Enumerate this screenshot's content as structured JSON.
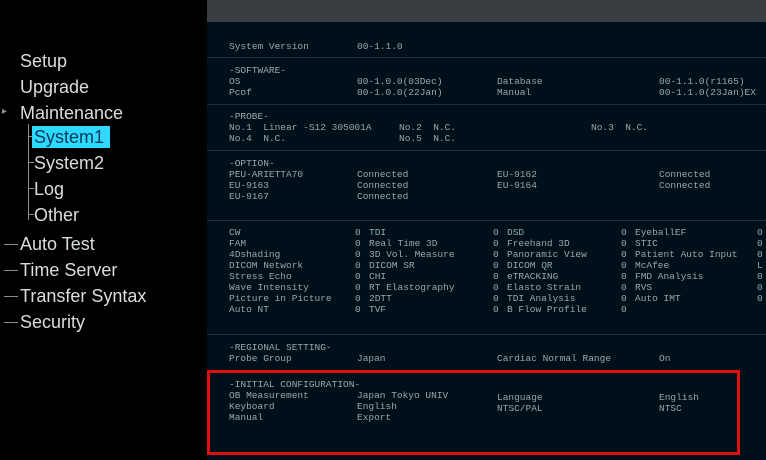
{
  "nav": {
    "setup": "Setup",
    "upgrade": "Upgrade",
    "maintenance": "Maintenance",
    "system1": "System1",
    "system2": "System2",
    "log": "Log",
    "other": "Other",
    "auto_test": "Auto Test",
    "time_server": "Time Server",
    "transfer_syntax": "Transfer Syntax",
    "security": "Security"
  },
  "system_version": {
    "label": "System Version",
    "value": "00-1.1.0"
  },
  "software": {
    "header": "-SOFTWARE-",
    "os_label": "OS",
    "os_value": "00-1.0.0(03Dec)",
    "pcof_label": "Pcof",
    "pcof_value": "00-1.0.0(22Jan)",
    "db_label": "Database",
    "db_value": "00-1.1.0(r1165)",
    "manual_label": "Manual",
    "manual_value": "00-1.1.0(23Jan)EX"
  },
  "probe": {
    "header": "-PROBE-",
    "no1": "No.1  Linear -S12 305001A",
    "no2": "No.2  N.C.",
    "no3": "No.3  N.C.",
    "no4": "No.4  N.C.",
    "no5": "No.5  N.C."
  },
  "option": {
    "header": "-OPTION-",
    "rows": [
      {
        "name": "PEU-ARIETTA70",
        "status": "Connected"
      },
      {
        "name": "EU-9163",
        "status": "Connected"
      },
      {
        "name": "EU-9167",
        "status": "Connected"
      },
      {
        "name": "EU-9162",
        "status": "Connected"
      },
      {
        "name": "EU-9164",
        "status": "Connected"
      }
    ]
  },
  "features": {
    "col1": [
      "CW",
      "FAM",
      "4Dshading",
      "DICOM Network",
      "Stress Echo",
      "Wave Intensity",
      "Picture in Picture",
      "Auto NT"
    ],
    "col1v": [
      "0",
      "0",
      "0",
      "0",
      "0",
      "0",
      "0",
      "0"
    ],
    "col2": [
      "TDI",
      "Real Time 3D",
      "3D Vol. Measure",
      "DICOM SR",
      "CHI",
      "RT Elastography",
      "2DTT",
      "TVF"
    ],
    "col2v": [
      "0",
      "0",
      "0",
      "0",
      "0",
      "0",
      "0",
      "0"
    ],
    "col3": [
      "DSD",
      "Freehand 3D",
      "Panoramic View",
      "DICOM QR",
      "eTRACKING",
      "Elasto Strain",
      "TDI Analysis",
      "B Flow Profile"
    ],
    "col3v": [
      "0",
      "0",
      "0",
      "0",
      "0",
      "0",
      "0",
      "0"
    ],
    "col4": [
      "EyeballEF",
      "STIC",
      "Patient Auto Input",
      "McAfee",
      "FMD Analysis",
      "RVS",
      "Auto IMT",
      ""
    ],
    "col4v": [
      "0",
      "0",
      "0",
      "L",
      "0",
      "0",
      "0",
      ""
    ]
  },
  "regional": {
    "header": "-REGIONAL SETTING-",
    "probe_group_label": "Probe Group",
    "probe_group_value": "Japan",
    "cardiac_label": "Cardiac Normal Range",
    "cardiac_value": "On"
  },
  "initial": {
    "header": "-INITIAL CONFIGURATION-",
    "ob_label": "OB Measurement",
    "ob_value": "Japan Tokyo UNIV",
    "lang_label": "Language",
    "lang_value": "English",
    "kbd_label": "Keyboard",
    "kbd_value": "English",
    "ntsc_label": "NTSC/PAL",
    "ntsc_value": "NTSC",
    "manual_label": "Manual",
    "manual_value": "Export"
  },
  "colors": {
    "highlight_border": "#e01010",
    "selected_bg": "#2fd8ff",
    "panel_bg": "#00101a"
  }
}
